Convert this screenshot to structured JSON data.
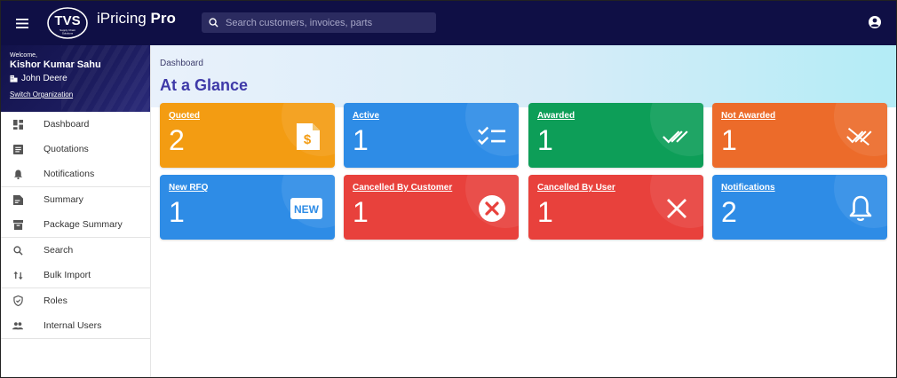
{
  "app": {
    "logo_text": "TVS",
    "logo_subtext": "Supply Chain Solutions",
    "title": "iPricing",
    "title_bold": "Pro"
  },
  "search": {
    "placeholder": "Search customers, invoices, parts"
  },
  "user": {
    "welcome": "Welcome,",
    "name": "Kishor Kumar Sahu",
    "organization": "John Deere",
    "switch_label": "Switch Organization"
  },
  "sidebar": {
    "groups": [
      [
        {
          "label": "Dashboard",
          "icon": "dashboard-icon"
        },
        {
          "label": "Quotations",
          "icon": "list-icon"
        },
        {
          "label": "Notifications",
          "icon": "bell-icon"
        }
      ],
      [
        {
          "label": "Summary",
          "icon": "summary-icon"
        },
        {
          "label": "Package Summary",
          "icon": "package-icon"
        }
      ],
      [
        {
          "label": "Search",
          "icon": "search-icon"
        },
        {
          "label": "Bulk Import",
          "icon": "swap-icon"
        }
      ],
      [
        {
          "label": "Roles",
          "icon": "shield-icon"
        },
        {
          "label": "Internal Users",
          "icon": "people-icon"
        }
      ]
    ]
  },
  "main": {
    "breadcrumb": "Dashboard",
    "title": "At a Glance",
    "cards": [
      {
        "title": "Quoted",
        "value": "2",
        "color": "#f39c12",
        "icon": "quote-dollar-icon"
      },
      {
        "title": "Active",
        "value": "1",
        "color": "#2e8ce6",
        "icon": "checklist-icon"
      },
      {
        "title": "Awarded",
        "value": "1",
        "color": "#0d9e58",
        "icon": "double-check-icon"
      },
      {
        "title": "Not Awarded",
        "value": "1",
        "color": "#ec6b2a",
        "icon": "remove-done-icon"
      },
      {
        "title": "New RFQ",
        "value": "1",
        "color": "#2e8ce6",
        "icon": "new-badge-icon",
        "badge": "NEW"
      },
      {
        "title": "Cancelled By Customer",
        "value": "1",
        "color": "#e8413c",
        "icon": "cancel-circle-icon"
      },
      {
        "title": "Cancelled By User",
        "value": "1",
        "color": "#e8413c",
        "icon": "close-icon"
      },
      {
        "title": "Notifications",
        "value": "2",
        "color": "#2e8ce6",
        "icon": "bell-icon"
      }
    ]
  }
}
